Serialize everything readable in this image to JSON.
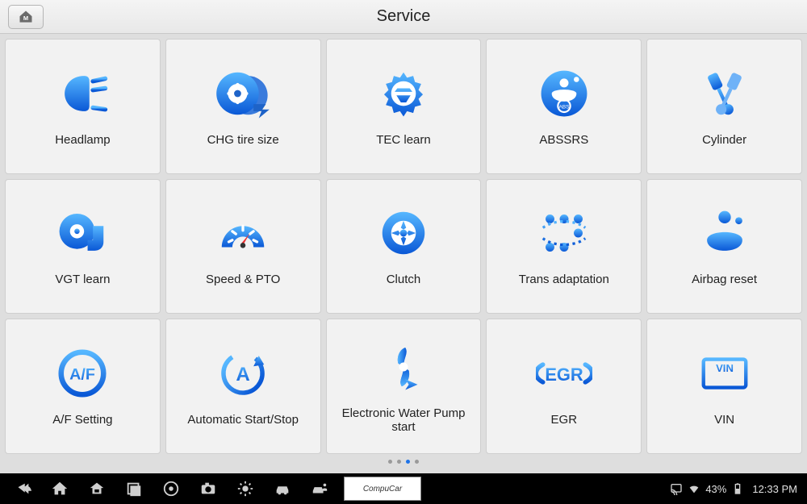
{
  "header": {
    "title": "Service"
  },
  "tiles": [
    {
      "id": "headlamp",
      "label": "Headlamp",
      "icon": "headlamp-icon"
    },
    {
      "id": "chg-tire",
      "label": "CHG tire size",
      "icon": "tire-icon"
    },
    {
      "id": "tec-learn",
      "label": "TEC learn",
      "icon": "gear-grad-icon"
    },
    {
      "id": "abssrs",
      "label": "ABSSRS",
      "icon": "abssrs-icon"
    },
    {
      "id": "cylinder",
      "label": "Cylinder",
      "icon": "pistons-icon"
    },
    {
      "id": "vgt-learn",
      "label": "VGT learn",
      "icon": "turbo-icon"
    },
    {
      "id": "speed-pto",
      "label": "Speed & PTO",
      "icon": "gauge-icon"
    },
    {
      "id": "clutch",
      "label": "Clutch",
      "icon": "clutch-icon"
    },
    {
      "id": "trans-adapt",
      "label": "Trans adaptation",
      "icon": "gearbox-icon"
    },
    {
      "id": "airbag",
      "label": "Airbag reset",
      "icon": "airbag-icon"
    },
    {
      "id": "af-setting",
      "label": "A/F Setting",
      "icon": "af-icon"
    },
    {
      "id": "auto-ss",
      "label": "Automatic Start/Stop",
      "icon": "autoss-icon"
    },
    {
      "id": "ewp",
      "label": "Electronic Water Pump start",
      "icon": "fan-arrow-icon"
    },
    {
      "id": "egr",
      "label": "EGR",
      "icon": "egr-icon"
    },
    {
      "id": "vin",
      "label": "VIN",
      "icon": "vin-icon"
    }
  ],
  "pagination": {
    "pages": 4,
    "active_index": 2
  },
  "navbar": {
    "logo_text": "CompuCar",
    "battery_pct": "43%",
    "clock": "12:33 PM"
  }
}
